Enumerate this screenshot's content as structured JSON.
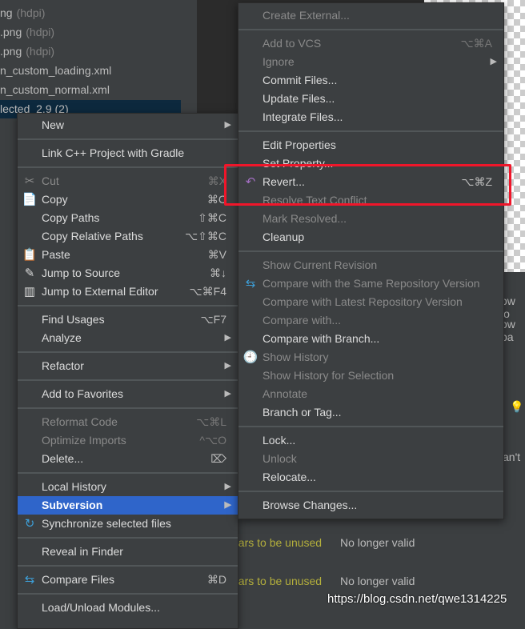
{
  "tree": [
    {
      "name": "ng",
      "hint": "(hdpi)"
    },
    {
      "name": ".png",
      "hint": "(hdpi)"
    },
    {
      "name": ".png",
      "hint": "(hdpi)"
    },
    {
      "name": "n_custom_loading.xml",
      "hint": ""
    },
    {
      "name": "n_custom_normal.xml",
      "hint": ""
    },
    {
      "name": "lected_2.9 (2)",
      "hint": ""
    }
  ],
  "main_menu": [
    {
      "label": "New",
      "arrow": true
    },
    {
      "sep": true
    },
    {
      "label": "Link C++ Project with Gradle"
    },
    {
      "sep": true
    },
    {
      "label": "Cut",
      "shortcut": "⌘X",
      "disabled": true,
      "icon": "✂"
    },
    {
      "label": "Copy",
      "shortcut": "⌘C",
      "icon": "📄"
    },
    {
      "label": "Copy Paths",
      "shortcut": "⇧⌘C"
    },
    {
      "label": "Copy Relative Paths",
      "shortcut": "⌥⇧⌘C"
    },
    {
      "label": "Paste",
      "shortcut": "⌘V",
      "icon": "📋"
    },
    {
      "label": "Jump to Source",
      "shortcut": "⌘↓",
      "icon": "✎"
    },
    {
      "label": "Jump to External Editor",
      "shortcut": "⌥⌘F4",
      "icon": "▥"
    },
    {
      "sep": true
    },
    {
      "label": "Find Usages",
      "shortcut": "⌥F7"
    },
    {
      "label": "Analyze",
      "arrow": true
    },
    {
      "sep": true
    },
    {
      "label": "Refactor",
      "arrow": true
    },
    {
      "sep": true
    },
    {
      "label": "Add to Favorites",
      "arrow": true
    },
    {
      "sep": true
    },
    {
      "label": "Reformat Code",
      "shortcut": "⌥⌘L",
      "disabled": true
    },
    {
      "label": "Optimize Imports",
      "shortcut": "^⌥O",
      "disabled": true
    },
    {
      "label": "Delete...",
      "shortcut": "⌦"
    },
    {
      "sep": true
    },
    {
      "label": "Local History",
      "arrow": true
    },
    {
      "label": "Subversion",
      "arrow": true,
      "highlighted": true
    },
    {
      "label": "Synchronize selected files",
      "icon": "↻"
    },
    {
      "sep": true
    },
    {
      "label": "Reveal in Finder"
    },
    {
      "sep": true
    },
    {
      "label": "Compare Files",
      "shortcut": "⌘D",
      "icon": "⇆"
    },
    {
      "sep": true
    },
    {
      "label": "Load/Unload Modules..."
    }
  ],
  "sub_menu": [
    {
      "label": "Create External...",
      "disabled": true
    },
    {
      "sep": true
    },
    {
      "label": "Add to VCS",
      "shortcut": "⌥⌘A",
      "disabled": true
    },
    {
      "label": "Ignore",
      "arrow": true,
      "disabled": true
    },
    {
      "label": "Commit Files..."
    },
    {
      "label": "Update Files..."
    },
    {
      "label": "Integrate Files..."
    },
    {
      "sep": true
    },
    {
      "label": "Edit Properties"
    },
    {
      "label": "Set Property..."
    },
    {
      "label": "Revert...",
      "shortcut": "⌥⌘Z",
      "icon": "↶"
    },
    {
      "label": "Resolve Text Conflict",
      "disabled": true
    },
    {
      "label": "Mark Resolved...",
      "disabled": true
    },
    {
      "label": "Cleanup"
    },
    {
      "sep": true
    },
    {
      "label": "Show Current Revision",
      "disabled": true
    },
    {
      "label": "Compare with the Same Repository Version",
      "disabled": true,
      "icon": "⇆"
    },
    {
      "label": "Compare with Latest Repository Version",
      "disabled": true
    },
    {
      "label": "Compare with...",
      "disabled": true
    },
    {
      "label": "Compare with Branch..."
    },
    {
      "label": "Show History",
      "disabled": true,
      "icon": "🕘"
    },
    {
      "label": "Show History for Selection",
      "disabled": true
    },
    {
      "label": "Annotate",
      "disabled": true
    },
    {
      "label": "Branch or Tag..."
    },
    {
      "sep": true
    },
    {
      "label": "Lock..."
    },
    {
      "label": "Unlock",
      "disabled": true
    },
    {
      "label": "Relocate..."
    },
    {
      "sep": true
    },
    {
      "label": "Browse Changes..."
    }
  ],
  "background": {
    "right_frag_1": "ow lo",
    "right_frag_2": "ow pa",
    "right_frag_3": "an't",
    "warn_text": "ears to be unused",
    "status_text": "No longer valid"
  },
  "watermark": "https://blog.csdn.net/qwe1314225",
  "colors": {
    "highlight": "#2f65ca",
    "annotation_box": "#f0162a",
    "warning": "#b3ae3c"
  }
}
